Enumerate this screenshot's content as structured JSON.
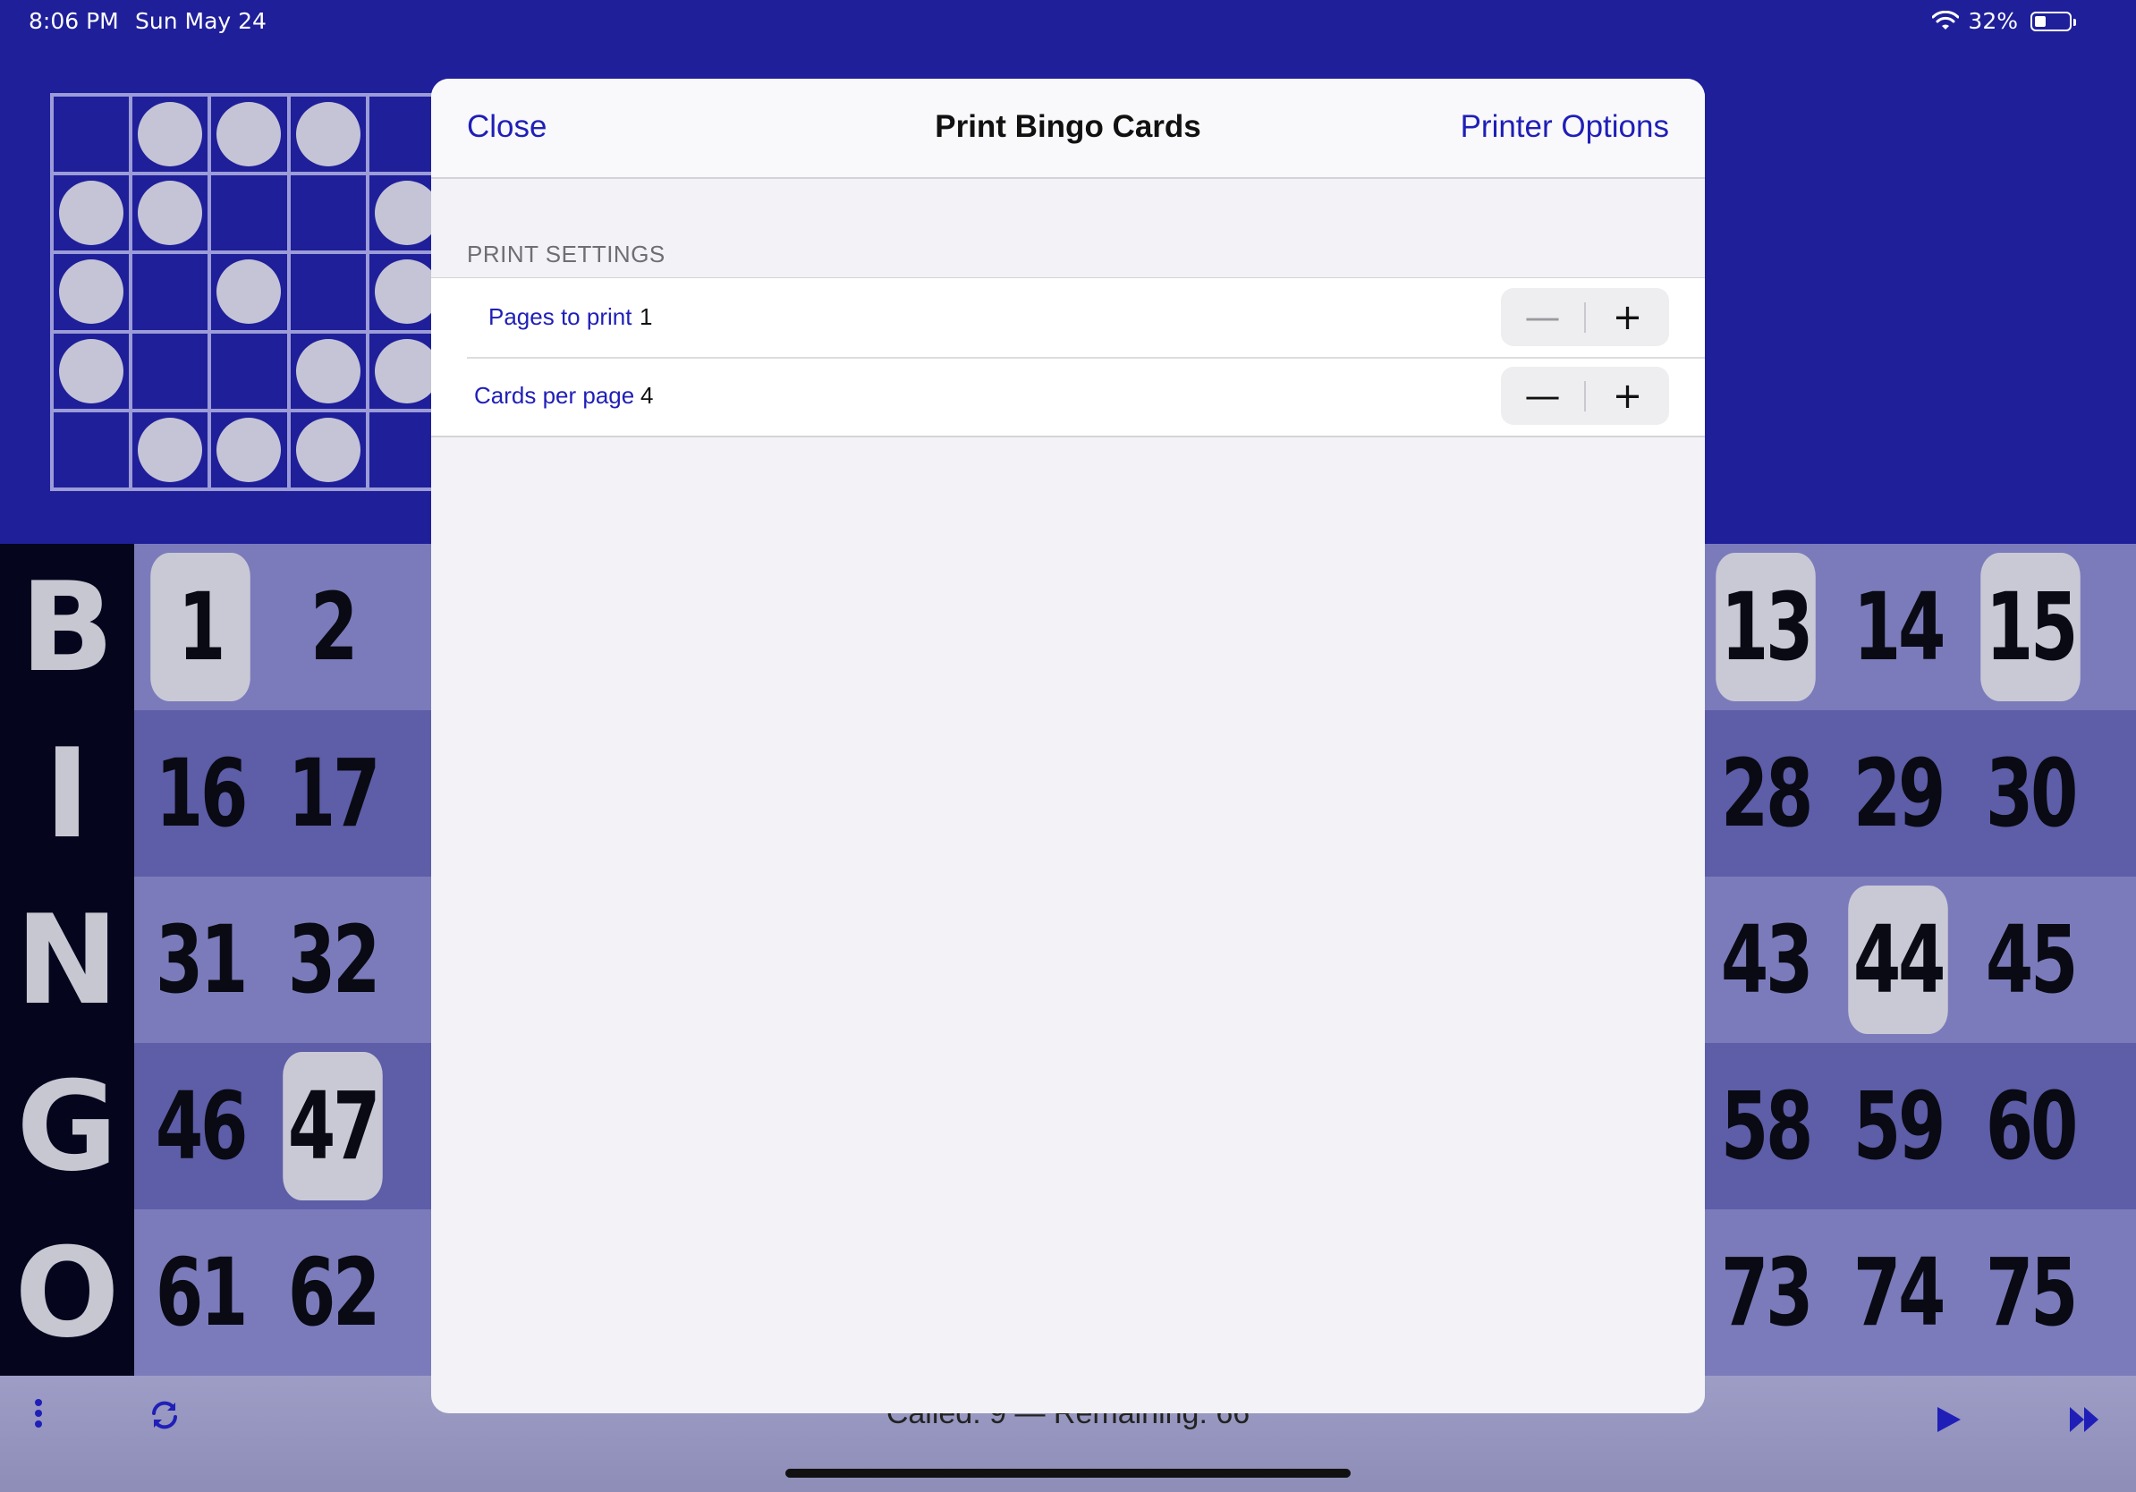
{
  "status_bar": {
    "time": "8:06 PM",
    "date": "Sun May 24",
    "battery": "32%",
    "battery_level": 0.32
  },
  "pattern": [
    [
      0,
      1,
      1,
      1,
      0
    ],
    [
      1,
      1,
      0,
      0,
      1
    ],
    [
      1,
      0,
      1,
      0,
      1
    ],
    [
      1,
      0,
      0,
      1,
      1
    ],
    [
      0,
      1,
      1,
      1,
      0
    ]
  ],
  "board": {
    "rows": [
      {
        "letter": "B",
        "left": [
          {
            "n": "1",
            "called": true
          },
          {
            "n": "2",
            "called": false
          }
        ],
        "right": [
          {
            "n": "13",
            "called": true
          },
          {
            "n": "14",
            "called": false
          },
          {
            "n": "15",
            "called": true
          }
        ]
      },
      {
        "letter": "I",
        "left": [
          {
            "n": "16",
            "called": false
          },
          {
            "n": "17",
            "called": false
          }
        ],
        "right": [
          {
            "n": "28",
            "called": false
          },
          {
            "n": "29",
            "called": false
          },
          {
            "n": "30",
            "called": false
          }
        ]
      },
      {
        "letter": "N",
        "left": [
          {
            "n": "31",
            "called": false
          },
          {
            "n": "32",
            "called": false
          }
        ],
        "right": [
          {
            "n": "43",
            "called": false
          },
          {
            "n": "44",
            "called": true
          },
          {
            "n": "45",
            "called": false
          }
        ]
      },
      {
        "letter": "G",
        "left": [
          {
            "n": "46",
            "called": false
          },
          {
            "n": "47",
            "called": true
          }
        ],
        "right": [
          {
            "n": "58",
            "called": false
          },
          {
            "n": "59",
            "called": false
          },
          {
            "n": "60",
            "called": false
          }
        ]
      },
      {
        "letter": "O",
        "left": [
          {
            "n": "61",
            "called": false
          },
          {
            "n": "62",
            "called": false
          }
        ],
        "right": [
          {
            "n": "73",
            "called": false
          },
          {
            "n": "74",
            "called": false
          },
          {
            "n": "75",
            "called": false
          }
        ]
      }
    ]
  },
  "toolbar": {
    "counter": "Called: 9 — Remaining: 66",
    "menu_icon": "more-vertical-icon",
    "refresh_icon": "refresh-icon",
    "play_icon": "play-icon",
    "fast_forward_icon": "fast-forward-icon"
  },
  "modal": {
    "close_label": "Close",
    "title": "Print Bingo Cards",
    "printer_options_label": "Printer Options",
    "section_header": "PRINT SETTINGS",
    "settings": [
      {
        "label": "Pages to print",
        "value": "1"
      },
      {
        "label": "Cards per page",
        "value": "4"
      }
    ]
  },
  "colors": {
    "accent": "#1f1fb8",
    "background": "#1f1f9a",
    "board_tile": "#7d7dbd",
    "called_tile": "#c9c9d6"
  }
}
